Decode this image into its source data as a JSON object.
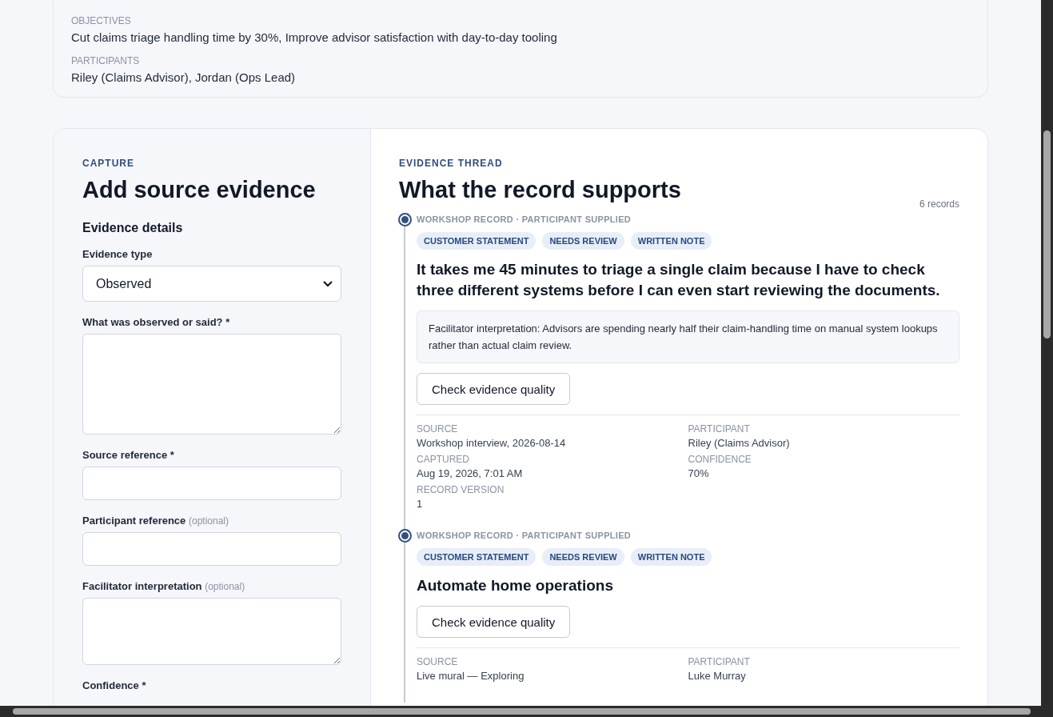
{
  "summary": {
    "fields": [
      {
        "label": "OBJECTIVES",
        "value": "Cut claims triage handling time by 30%, Improve advisor satisfaction with day-to-day tooling"
      },
      {
        "label": "PARTICIPANTS",
        "value": "Riley (Claims Advisor), Jordan (Ops Lead)"
      }
    ]
  },
  "capture": {
    "eyebrow": "CAPTURE",
    "title": "Add source evidence",
    "section": "Evidence details",
    "fields": [
      {
        "kind": "select",
        "label": "Evidence type",
        "value": "Observed"
      },
      {
        "kind": "textarea",
        "label": "What was observed or said? *"
      },
      {
        "kind": "input",
        "label": "Source reference *"
      },
      {
        "kind": "input",
        "label": "Participant reference",
        "hint": "(optional)"
      },
      {
        "kind": "notes",
        "label": "Facilitator interpretation",
        "hint": "(optional)"
      },
      {
        "kind": "label",
        "label": "Confidence *"
      }
    ]
  },
  "thread": {
    "eyebrow": "EVIDENCE THREAD",
    "title": "What the record supports",
    "count": "6 records",
    "records": [
      {
        "meta": "WORKSHOP RECORD · PARTICIPANT SUPPLIED",
        "tags": [
          "CUSTOMER STATEMENT",
          "NEEDS REVIEW",
          "WRITTEN NOTE"
        ],
        "statement": "It takes me 45 minutes to triage a single claim because I have to check three different systems before I can even start reviewing the documents.",
        "interpretation": "Facilitator interpretation: Advisors are spending nearly half their claim-handling time on manual system lookups rather than actual claim review.",
        "button": "Check evidence quality",
        "details": [
          {
            "label": "SOURCE",
            "value": "Workshop interview, 2026-08-14"
          },
          {
            "label": "PARTICIPANT",
            "value": "Riley (Claims Advisor)"
          },
          {
            "label": "CAPTURED",
            "value": "Aug 19, 2026, 7:01 AM"
          },
          {
            "label": "CONFIDENCE",
            "value": "70%"
          },
          {
            "label": "RECORD VERSION",
            "value": "1"
          }
        ]
      },
      {
        "meta": "WORKSHOP RECORD · PARTICIPANT SUPPLIED",
        "tags": [
          "CUSTOMER STATEMENT",
          "NEEDS REVIEW",
          "WRITTEN NOTE"
        ],
        "statement": "Automate home operations",
        "button": "Check evidence quality",
        "details": [
          {
            "label": "SOURCE",
            "value": "Live mural — Exploring"
          },
          {
            "label": "PARTICIPANT",
            "value": "Luke Murray"
          }
        ]
      }
    ]
  }
}
